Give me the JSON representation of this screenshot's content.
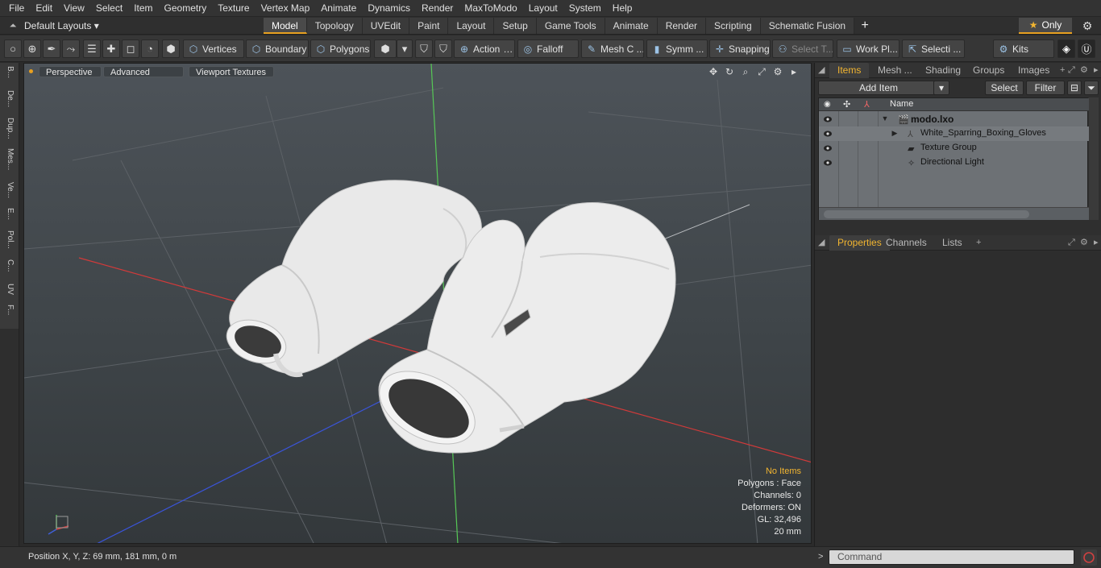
{
  "menu": [
    "File",
    "Edit",
    "View",
    "Select",
    "Item",
    "Geometry",
    "Texture",
    "Vertex Map",
    "Animate",
    "Dynamics",
    "Render",
    "MaxToModo",
    "Layout",
    "System",
    "Help"
  ],
  "layouts": {
    "label": "Default Layouts ▾"
  },
  "tabs": [
    "Model",
    "Topology",
    "UVEdit",
    "Paint",
    "Layout",
    "Setup",
    "Game Tools",
    "Animate",
    "Render",
    "Scripting",
    "Schematic Fusion"
  ],
  "active_tab": "Model",
  "only_label": "Only",
  "toolbar": {
    "vertices": "Vertices",
    "boundary": "Boundary",
    "polygons": "Polygons",
    "action": "Action",
    "falloff": "Falloff",
    "mesh": "Mesh C ...",
    "symm": "Symm ...",
    "snapping": "Snapping",
    "select_t": "Select T...",
    "work_pl": "Work Pl...",
    "selecti": "Selecti ...",
    "kits": "Kits"
  },
  "vstrip": [
    "B...",
    "De...",
    "Dup...",
    "Mes...",
    "Ve...",
    "E...",
    "Pol...",
    "C...",
    "UV",
    "F..."
  ],
  "viewport": {
    "perspective": "Perspective",
    "advanced": "Advanced",
    "viewport_textures": "Viewport Textures",
    "info": {
      "no_items": "No Items",
      "polygons": "Polygons : Face",
      "channels": "Channels: 0",
      "deformers": "Deformers: ON",
      "gl": "GL: 32,496",
      "scale": "20 mm"
    }
  },
  "status": {
    "position": "Position X, Y, Z:   69 mm, 181 mm, 0 m"
  },
  "items_panel": {
    "tabs": [
      "Items",
      "Mesh ...",
      "Shading",
      "Groups",
      "Images"
    ],
    "add_item": "Add Item",
    "select": "Select",
    "filter": "Filter",
    "name_header": "Name",
    "rows": [
      {
        "name": "modo.lxo",
        "bold": true
      },
      {
        "name": "White_Sparring_Boxing_Gloves"
      },
      {
        "name": "Texture Group"
      },
      {
        "name": "Directional Light"
      }
    ]
  },
  "props_panel": {
    "tabs": [
      "Properties",
      "Channels",
      "Lists"
    ]
  },
  "command": {
    "placeholder": "Command"
  }
}
